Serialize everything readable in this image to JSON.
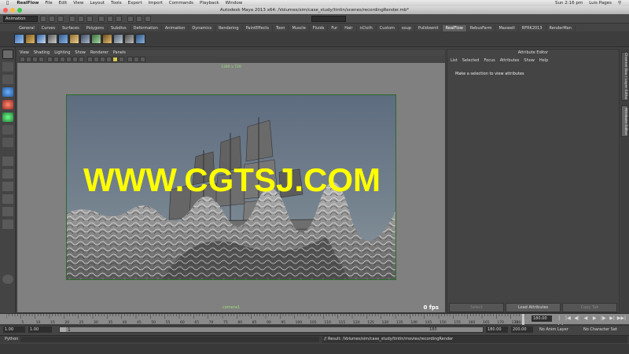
{
  "menubar": {
    "app": "RealFlow",
    "items": [
      "File",
      "Edit",
      "View",
      "Layout",
      "Tools",
      "Export",
      "Import",
      "Commands",
      "Playback",
      "Window"
    ],
    "clock": "Sun 2:16 pm",
    "user": "Luis Pages"
  },
  "window": {
    "title": "Autodesk Maya 2013 x64: /Volumes/sim/case_study/tintin/scenes/recordingRender.mb*"
  },
  "statusline": {
    "mode": "Animation"
  },
  "shelf": {
    "tabs": [
      "General",
      "Curves",
      "Surfaces",
      "Polygons",
      "Subdivs",
      "Deformation",
      "Animation",
      "Dynamics",
      "Rendering",
      "PaintEffects",
      "Toon",
      "Muscle",
      "Fluids",
      "Fur",
      "Hair",
      "nCloth",
      "Custom",
      "soup",
      "Pulldownit",
      "RealFlow",
      "RebusFarm",
      "Maxwell",
      "RFRK2013",
      "RenderMan"
    ],
    "active_tab": "RealFlow"
  },
  "viewport": {
    "menu": [
      "View",
      "Shading",
      "Lighting",
      "Show",
      "Renderer",
      "Panels"
    ],
    "resolution_gate": "1280 x 720",
    "camera": "camera1",
    "fps": "0 fps",
    "watermark": "WWW.CGTSJ.COM"
  },
  "attribute_editor": {
    "title": "Attribute Editor",
    "menu": [
      "List",
      "Selected",
      "Focus",
      "Attributes",
      "Show",
      "Help"
    ],
    "message": "Make a selection to view attributes",
    "buttons": {
      "select": "Select",
      "load": "Load Attributes",
      "copy": "Copy Tab"
    }
  },
  "side_tabs": {
    "channel_box": "Channel Box / Layer Editor",
    "attribute_editor": "Attribute Editor"
  },
  "time_slider": {
    "tick_labels": [
      "5",
      "10",
      "15",
      "20",
      "25",
      "30",
      "35",
      "40",
      "45",
      "50",
      "55",
      "60",
      "65",
      "70",
      "75",
      "80",
      "85",
      "90",
      "95",
      "100",
      "105",
      "110",
      "115",
      "120",
      "125",
      "130",
      "135",
      "140",
      "145",
      "150",
      "155",
      "160",
      "165",
      "170",
      "175"
    ],
    "end_tick": "180",
    "current_time": "180.00",
    "playback_buttons": [
      "|◀◀",
      "|◀",
      "◀|",
      "◀",
      "▶",
      "|▶",
      "▶|",
      "▶▶|"
    ]
  },
  "range_slider": {
    "start_time": "1.00",
    "start_range": "1.00",
    "range_start_label": "1",
    "range_end_label": "180",
    "end_range": "180.00",
    "end_time": "200.00",
    "anim_layer": "No Anim Layer",
    "character_set": "No Character Set"
  },
  "command_line": {
    "language": "Python",
    "result": "// Result: /Volumes/sim/case_study/tintin/movies/recordingRender"
  },
  "colors": {
    "accent_green": "#9cde7a",
    "watermark_yellow": "#ffff00"
  }
}
